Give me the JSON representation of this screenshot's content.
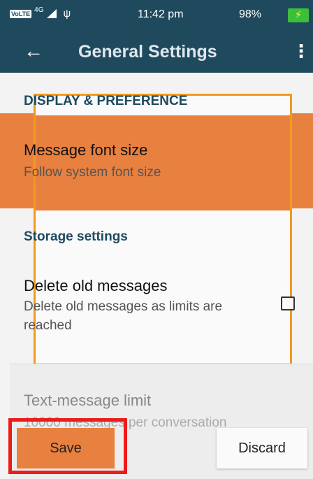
{
  "status_bar": {
    "volte": "VoLTE",
    "network": "4G",
    "usb_symbol": "ψ",
    "time": "11:42 pm",
    "battery": "98%",
    "battery_charging_symbol": "⚡"
  },
  "app_bar": {
    "title": "General Settings",
    "back_icon": "arrow-left-icon",
    "overflow_icon": "more-vert-icon"
  },
  "settings": {
    "display_header": "DISPLAY & PREFERENCE",
    "font_size_title": "Message font size",
    "font_size_sub": "Follow system font size",
    "storage_header": "Storage settings",
    "delete_title": "Delete old messages",
    "delete_sub_line1": "Delete old messages as limits are",
    "delete_sub_line2": "reached",
    "delete_checked": false,
    "text_limit_title": "Text-message limit",
    "text_limit_sub": "10000 messages per conversation"
  },
  "buttons": {
    "save": "Save",
    "discard": "Discard"
  },
  "colors": {
    "primary": "#1f4a5e",
    "accent": "#e8803f",
    "dialog_border": "#f29a1f",
    "save_highlight": "#ee1b1b"
  }
}
